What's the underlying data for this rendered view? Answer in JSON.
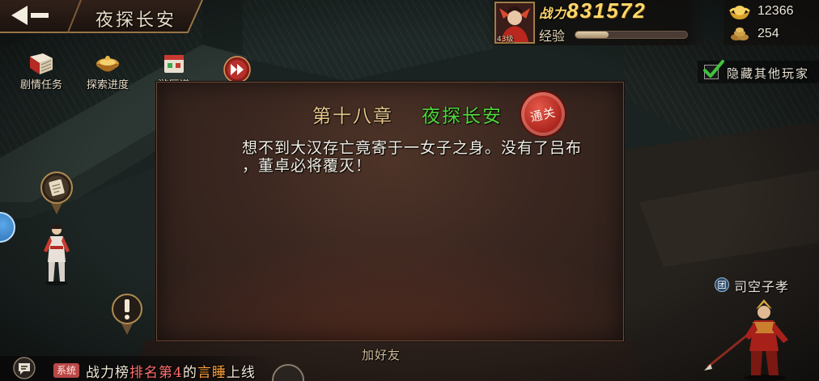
{
  "header": {
    "title": "夜探长安"
  },
  "player": {
    "avatar_level": "43级",
    "power_label": "战力",
    "power_value": "831572",
    "exp_label": "经验",
    "exp_progress": 0.3
  },
  "currencies": [
    {
      "icon": "gold-ingot-icon",
      "value": "12366"
    },
    {
      "icon": "coin-pile-icon",
      "value": "254"
    }
  ],
  "hide_players": {
    "label": "隐藏其他玩家",
    "checked": true
  },
  "shortcuts": [
    {
      "icon": "book-icon",
      "label": "剧情任务"
    },
    {
      "icon": "treasure-icon",
      "label": "探索进度"
    },
    {
      "icon": "scroll-icon",
      "label": "游历谱"
    }
  ],
  "skip_icon": "fast-forward-icon",
  "dialog": {
    "chapter": "第十八章",
    "chapter_name": "夜探长安",
    "seal": "通关",
    "lines": [
      "想不到大汉存亡竟寄于一女子之身。没有了吕布",
      "，董卓必将覆灭！"
    ]
  },
  "add_friend_label": "加好友",
  "nearby_player": {
    "guild_badge": "团",
    "name": "司空子孝"
  },
  "chat": {
    "channel": "系统",
    "segments": [
      {
        "text": "战力榜",
        "color": "#f2ead8"
      },
      {
        "text": "排名第4",
        "color": "#ff6f6f"
      },
      {
        "text": "的",
        "color": "#f2ead8"
      },
      {
        "text": "言睡",
        "color": "#ff9f3a"
      },
      {
        "text": "上线",
        "color": "#f2ead8"
      }
    ]
  },
  "colors": {
    "chapter": "#e6c489",
    "chapter_name": "#4fd63a",
    "power": "#ffd76a",
    "check": "#3ec43e",
    "seal": "#c9302a"
  }
}
